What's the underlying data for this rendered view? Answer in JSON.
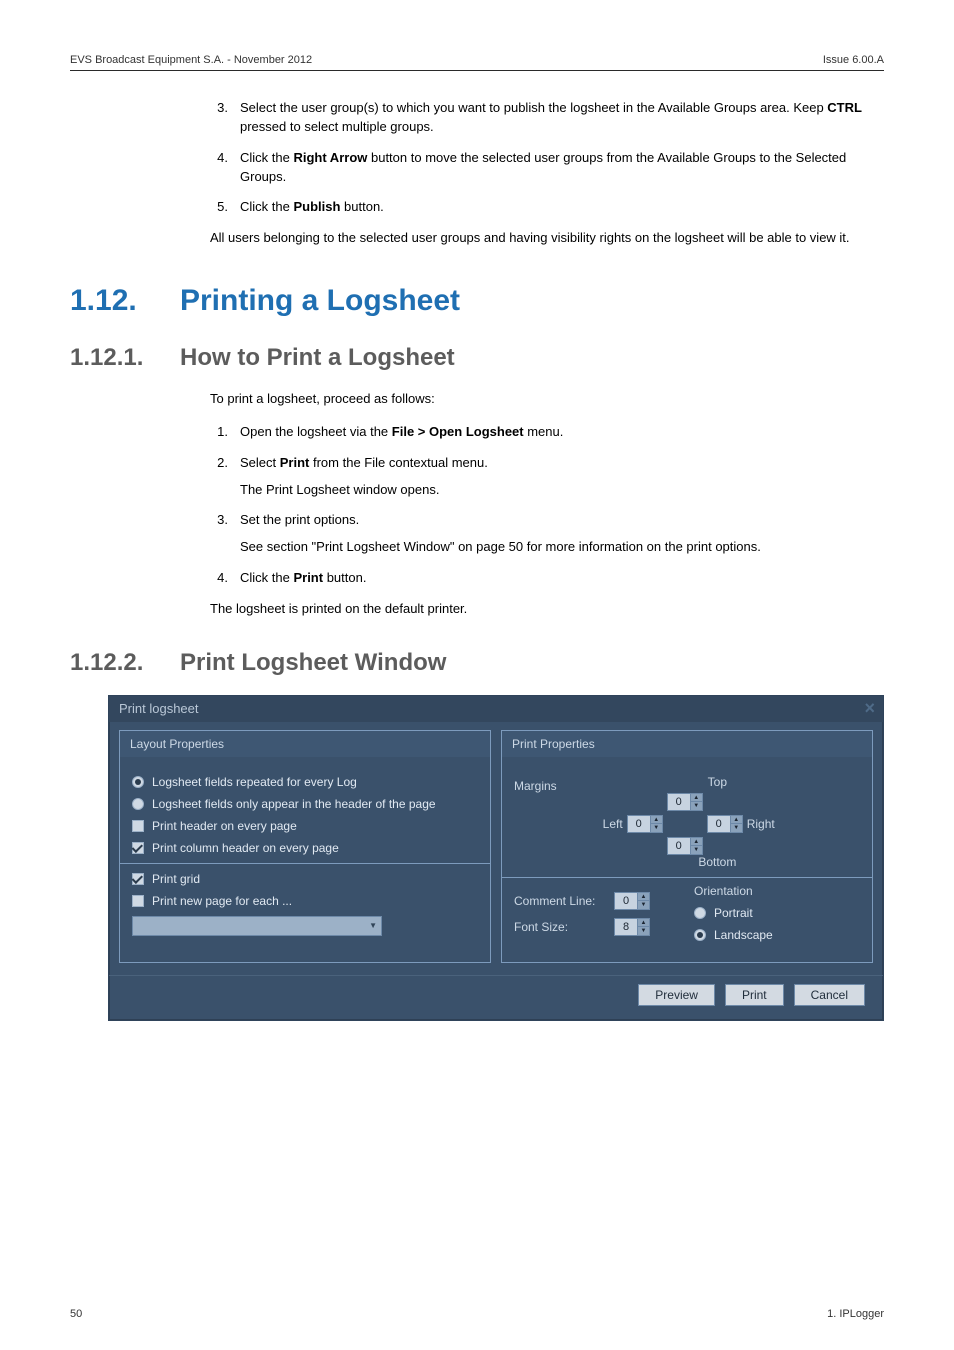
{
  "header": {
    "left": "EVS Broadcast Equipment S.A. - November 2012",
    "right": "Issue 6.00.A"
  },
  "intro_steps": [
    {
      "n": "3.",
      "text": "Select the user group(s) to which you want to publish the logsheet in the Available Groups area. Keep ",
      "bold1": "CTRL",
      "text2": " pressed to select multiple groups."
    },
    {
      "n": "4.",
      "text": "Click the ",
      "bold1": "Right Arrow",
      "text2": " button to move the selected user groups from the Available Groups to the Selected Groups."
    },
    {
      "n": "5.",
      "text": "Click the ",
      "bold1": "Publish",
      "text2": " button."
    }
  ],
  "intro_para": "All users belonging to the selected user groups and having visibility rights on the logsheet will be able to view it.",
  "h1": {
    "num": "1.12.",
    "title": "Printing a Logsheet"
  },
  "h2a": {
    "num": "1.12.1.",
    "title": "How to Print a Logsheet"
  },
  "howto_intro": "To print a logsheet, proceed as follows:",
  "howto_steps": {
    "s1": {
      "n": "1.",
      "pre": "Open the logsheet via the ",
      "bold": "File > Open Logsheet",
      "post": " menu."
    },
    "s2": {
      "n": "2.",
      "pre": "Select ",
      "bold": "Print",
      "post": " from the File contextual menu.",
      "after": "The Print Logsheet window opens."
    },
    "s3": {
      "n": "3.",
      "pre": "Set the print options.",
      "after": "See section \"Print Logsheet Window\" on page 50 for more information on the print options."
    },
    "s4": {
      "n": "4.",
      "pre": "Click the ",
      "bold": "Print",
      "post": " button."
    }
  },
  "howto_out": "The logsheet is printed on the default printer.",
  "h2b": {
    "num": "1.12.2.",
    "title": "Print Logsheet Window"
  },
  "dialog": {
    "title": "Print logsheet",
    "layout_title": "Layout Properties",
    "print_title": "Print Properties",
    "opts": {
      "repeated": "Logsheet fields repeated for every Log",
      "header_only": "Logsheet fields only appear in the header of the page",
      "print_header": "Print header on every page",
      "print_col_header": "Print column header on every page",
      "print_grid": "Print grid",
      "print_new_page": "Print new page for each ..."
    },
    "margins_label": "Margins",
    "margin_top": "Top",
    "margin_bottom": "Bottom",
    "margin_left": "Left",
    "margin_right": "Right",
    "margin_vals": {
      "top": "0",
      "left": "0",
      "right": "0",
      "bottom": "0"
    },
    "comment_line": "Comment Line:",
    "comment_val": "0",
    "font_size": "Font Size:",
    "font_val": "8",
    "orientation": "Orientation",
    "portrait": "Portrait",
    "landscape": "Landscape",
    "buttons": {
      "preview": "Preview",
      "print": "Print",
      "cancel": "Cancel"
    }
  },
  "footer": {
    "left": "50",
    "right": "1. IPLogger"
  }
}
